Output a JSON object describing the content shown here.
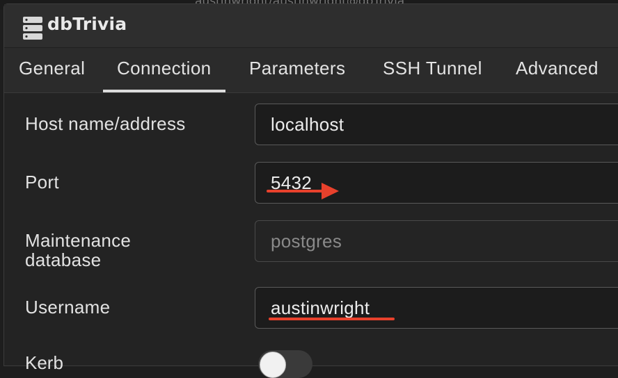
{
  "app": {
    "title": "dbTrivia"
  },
  "background": {
    "ghost_text": "austinwright/austinwright@dbTrivia"
  },
  "tabs": [
    {
      "label": "General"
    },
    {
      "label": "Connection"
    },
    {
      "label": "Parameters"
    },
    {
      "label": "SSH Tunnel"
    },
    {
      "label": "Advanced"
    }
  ],
  "active_tab": "Connection",
  "form": {
    "host": {
      "label": "Host name/address",
      "value": "localhost"
    },
    "port": {
      "label": "Port",
      "value": "5432"
    },
    "maintenance_db": {
      "label_line1": "Maintenance",
      "label_line2": "database",
      "placeholder": "postgres"
    },
    "username": {
      "label": "Username",
      "value": "austinwright"
    },
    "next_label_partial": "Kerb"
  },
  "colors": {
    "annotation_red": "#e8412c"
  },
  "icons": {
    "app": "server-stack-icon",
    "annotation": "red-arrow-icon"
  }
}
